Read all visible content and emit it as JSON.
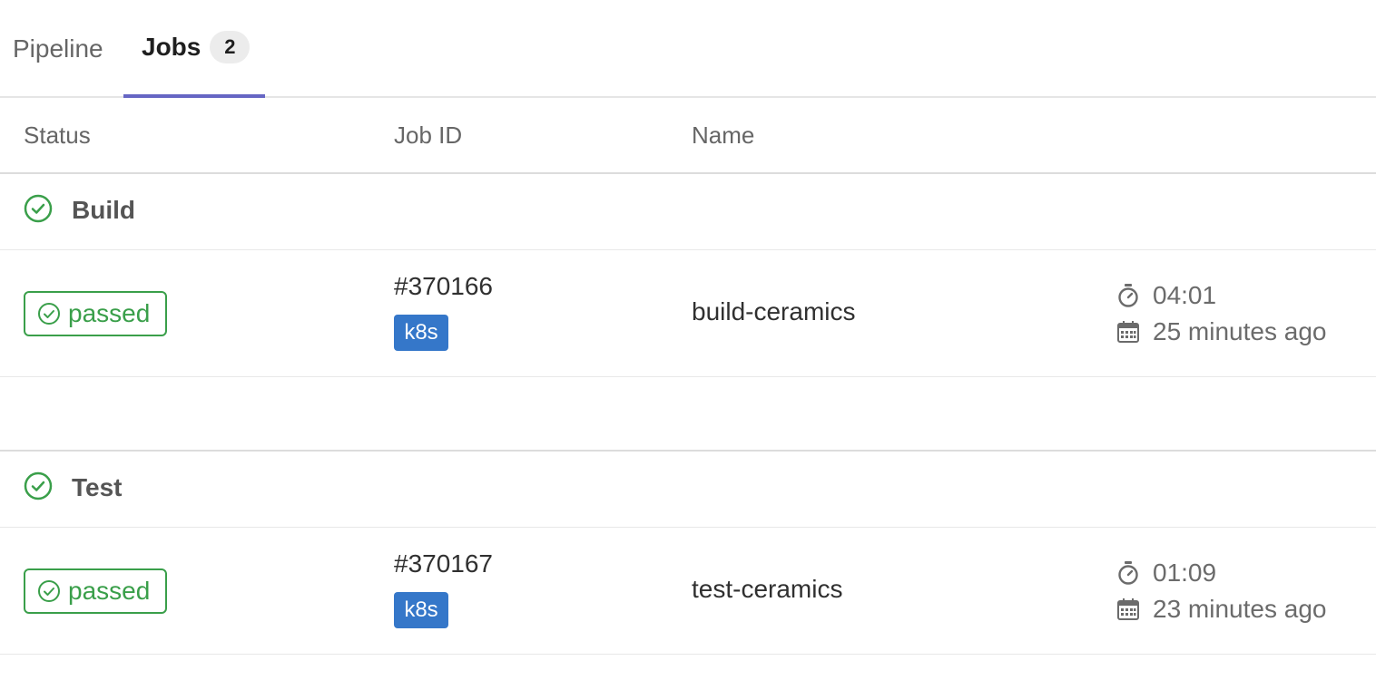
{
  "tabs": [
    {
      "label": "Pipeline"
    },
    {
      "label": "Jobs",
      "count": "2"
    }
  ],
  "columns": {
    "status": "Status",
    "job_id": "Job ID",
    "name": "Name"
  },
  "stages": [
    {
      "title": "Build",
      "icon": "check-circle-icon",
      "job": {
        "status": "passed",
        "id": "#370166",
        "tag": "k8s",
        "name": "build-ceramics",
        "duration": "04:01",
        "finished": "25 minutes ago"
      }
    },
    {
      "title": "Test",
      "icon": "check-circle-icon",
      "job": {
        "status": "passed",
        "id": "#370167",
        "tag": "k8s",
        "name": "test-ceramics",
        "duration": "01:09",
        "finished": "23 minutes ago"
      }
    }
  ],
  "colors": {
    "success": "#3a9f4a",
    "tag": "#3577c9",
    "active_tab_underline": "#6666c4"
  }
}
